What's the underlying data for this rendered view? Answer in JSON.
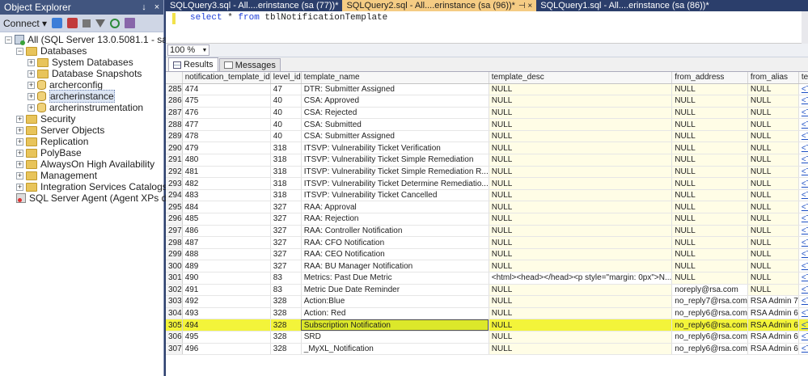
{
  "object_explorer": {
    "title": "Object Explorer",
    "pin": "↓",
    "close": "×",
    "connect_label": "Connect ▾",
    "tree": [
      {
        "label": "All (SQL Server 13.0.5081.1 - sa)",
        "icon": "server-icon",
        "expander": "−",
        "level": 0
      },
      {
        "label": "Databases",
        "icon": "folder-icon",
        "expander": "−",
        "level": 1
      },
      {
        "label": "System Databases",
        "icon": "folder-icon",
        "expander": "+",
        "level": 2
      },
      {
        "label": "Database Snapshots",
        "icon": "folder-icon",
        "expander": "+",
        "level": 2
      },
      {
        "label": "archerconfig",
        "icon": "database-icon",
        "expander": "+",
        "level": 2
      },
      {
        "label": "archerinstance",
        "icon": "database-icon",
        "expander": "+",
        "level": 2
      },
      {
        "label": "archerinstrumentation",
        "icon": "database-icon",
        "expander": "+",
        "level": 2
      },
      {
        "label": "Security",
        "icon": "folder-icon",
        "expander": "+",
        "level": 1
      },
      {
        "label": "Server Objects",
        "icon": "folder-icon",
        "expander": "+",
        "level": 1
      },
      {
        "label": "Replication",
        "icon": "folder-icon",
        "expander": "+",
        "level": 1
      },
      {
        "label": "PolyBase",
        "icon": "folder-icon",
        "expander": "+",
        "level": 1
      },
      {
        "label": "AlwaysOn High Availability",
        "icon": "folder-icon",
        "expander": "+",
        "level": 1
      },
      {
        "label": "Management",
        "icon": "folder-icon",
        "expander": "+",
        "level": 1
      },
      {
        "label": "Integration Services Catalogs",
        "icon": "folder-icon",
        "expander": "+",
        "level": 1
      },
      {
        "label": "SQL Server Agent (Agent XPs disabl",
        "icon": "agent-icon",
        "expander": "",
        "level": 1
      }
    ]
  },
  "doc_tabs": [
    {
      "label": "SQLQuery3.sql - All....erinstance (sa (77))*",
      "active": false,
      "pin": ""
    },
    {
      "label": "SQLQuery2.sql - All....erinstance (sa (96))*",
      "active": true,
      "pin": "⊣ ×"
    },
    {
      "label": "SQLQuery1.sql - All....erinstance (sa (86))*",
      "active": false,
      "pin": ""
    }
  ],
  "editor": {
    "kw1": "select",
    "rest": " * ",
    "kw2": "from",
    "table": " tblNotificationTemplate"
  },
  "zoom": "100 %",
  "result_tabs": {
    "results": "Results",
    "messages": "Messages"
  },
  "grid": {
    "columns": [
      "",
      "notification_template_id",
      "level_id",
      "template_name",
      "template_desc",
      "from_address",
      "from_alias",
      "temp"
    ],
    "rows": [
      [
        "285",
        "474",
        "47",
        "DTR: Submitter Assigned",
        "NULL",
        "NULL",
        "NULL",
        "<Te"
      ],
      [
        "286",
        "475",
        "40",
        "CSA: Approved",
        "NULL",
        "NULL",
        "NULL",
        "<Te"
      ],
      [
        "287",
        "476",
        "40",
        "CSA: Rejected",
        "NULL",
        "NULL",
        "NULL",
        "<Te"
      ],
      [
        "288",
        "477",
        "40",
        "CSA: Submitted",
        "NULL",
        "NULL",
        "NULL",
        "<Te"
      ],
      [
        "289",
        "478",
        "40",
        "CSA: Submitter Assigned",
        "NULL",
        "NULL",
        "NULL",
        "<Te"
      ],
      [
        "290",
        "479",
        "318",
        "ITSVP: Vulnerability Ticket Verification",
        "NULL",
        "NULL",
        "NULL",
        "<Te"
      ],
      [
        "291",
        "480",
        "318",
        "ITSVP: Vulnerability Ticket Simple Remediation",
        "NULL",
        "NULL",
        "NULL",
        "<Te"
      ],
      [
        "292",
        "481",
        "318",
        "ITSVP: Vulnerability Ticket Simple Remediation R...",
        "NULL",
        "NULL",
        "NULL",
        "<Te"
      ],
      [
        "293",
        "482",
        "318",
        "ITSVP: Vulnerability Ticket Determine Remediatio...",
        "NULL",
        "NULL",
        "NULL",
        "<Te"
      ],
      [
        "294",
        "483",
        "318",
        "ITSVP: Vulnerability Ticket Cancelled",
        "NULL",
        "NULL",
        "NULL",
        "<Te"
      ],
      [
        "295",
        "484",
        "327",
        "RAA: Approval",
        "NULL",
        "NULL",
        "NULL",
        "<Te"
      ],
      [
        "296",
        "485",
        "327",
        "RAA: Rejection",
        "NULL",
        "NULL",
        "NULL",
        "<Te"
      ],
      [
        "297",
        "486",
        "327",
        "RAA: Controller Notification",
        "NULL",
        "NULL",
        "NULL",
        "<Te"
      ],
      [
        "298",
        "487",
        "327",
        "RAA: CFO Notification",
        "NULL",
        "NULL",
        "NULL",
        "<Te"
      ],
      [
        "299",
        "488",
        "327",
        "RAA: CEO Notification",
        "NULL",
        "NULL",
        "NULL",
        "<Te"
      ],
      [
        "300",
        "489",
        "327",
        "RAA: BU Manager Notification",
        "NULL",
        "NULL",
        "NULL",
        "<Te"
      ],
      [
        "301",
        "490",
        "83",
        "Metrics: Past Due Metric",
        "<html><head></head><p style=\"margin: 0px\">N...",
        "NULL",
        "NULL",
        "<Te"
      ],
      [
        "302",
        "491",
        "83",
        "Metric Due Date Reminder",
        "NULL",
        "noreply@rsa.com",
        "NULL",
        "<Te"
      ],
      [
        "303",
        "492",
        "328",
        "Action:Blue",
        "NULL",
        "no_reply7@rsa.com",
        "RSA Admin 7",
        "<Te"
      ],
      [
        "304",
        "493",
        "328",
        "Action: Red",
        "NULL",
        "no_reply6@rsa.com",
        "RSA Admin 6",
        "<Te"
      ],
      [
        "305",
        "494",
        "328",
        "Subscription Notification",
        "NULL",
        "no_reply6@rsa.com",
        "RSA Admin 6",
        "<Te"
      ],
      [
        "306",
        "495",
        "328",
        "SRD",
        "NULL",
        "no_reply6@rsa.com",
        "RSA Admin 6",
        "<Te"
      ],
      [
        "307",
        "496",
        "328",
        "_MyXL_Notification",
        "NULL",
        "no_reply6@rsa.com",
        "RSA Admin 6",
        "<Te"
      ]
    ],
    "highlighted_row": "305"
  }
}
